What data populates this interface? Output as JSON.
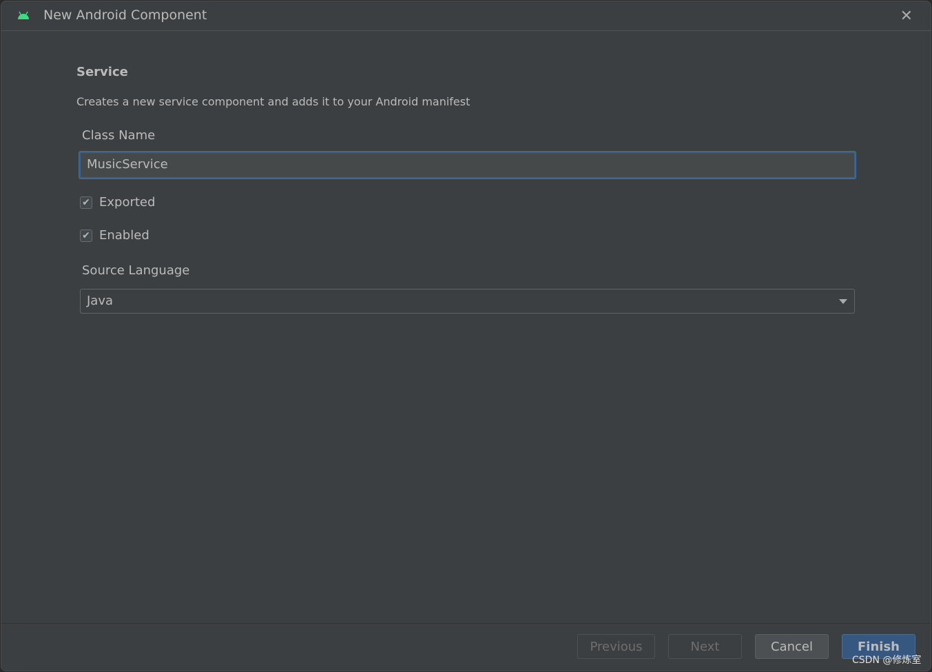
{
  "window": {
    "title": "New Android Component",
    "close_icon": "close-icon",
    "app_icon": "android-icon",
    "accent": "#3ddc84"
  },
  "form": {
    "heading": "Service",
    "description": "Creates a new service component and adds it to your Android manifest",
    "class_name_label": "Class Name",
    "class_name_value": "MusicService",
    "exported_label": "Exported",
    "exported_checked": true,
    "enabled_label": "Enabled",
    "enabled_checked": true,
    "source_language_label": "Source Language",
    "source_language_value": "Java"
  },
  "buttons": {
    "previous": "Previous",
    "next": "Next",
    "cancel": "Cancel",
    "finish": "Finish",
    "finish_color": "#365880"
  },
  "watermark": "CSDN @修炼室"
}
